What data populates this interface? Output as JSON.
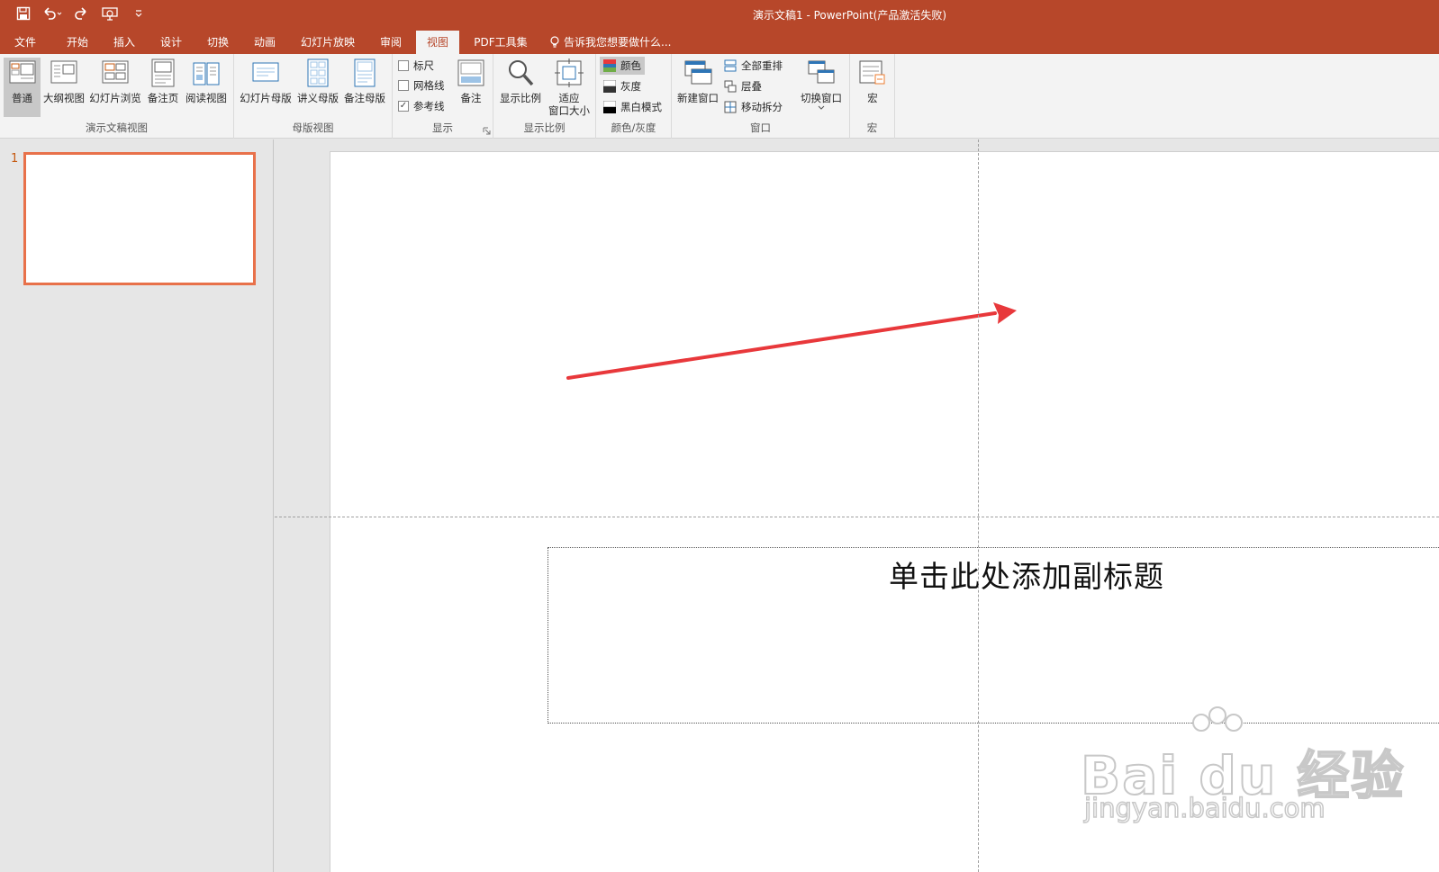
{
  "window": {
    "title": "演示文稿1 - PowerPoint(产品激活失败)"
  },
  "qat": {
    "save_icon": "save-icon",
    "undo_icon": "undo-icon",
    "redo_icon": "redo-icon",
    "present_icon": "present-from-start-icon",
    "customize_icon": "customize-qat-icon"
  },
  "tabs": [
    {
      "label": "文件"
    },
    {
      "label": "开始"
    },
    {
      "label": "插入"
    },
    {
      "label": "设计"
    },
    {
      "label": "切换"
    },
    {
      "label": "动画"
    },
    {
      "label": "幻灯片放映"
    },
    {
      "label": "审阅"
    },
    {
      "label": "视图",
      "active": true
    },
    {
      "label": "PDF工具集"
    }
  ],
  "tell_me": "告诉我您想要做什么...",
  "ribbon": {
    "presentation_views": {
      "label": "演示文稿视图",
      "buttons": [
        {
          "label": "普通",
          "active": true
        },
        {
          "label": "大纲视图"
        },
        {
          "label": "幻灯片浏览"
        },
        {
          "label": "备注页"
        },
        {
          "label": "阅读视图"
        }
      ]
    },
    "master_views": {
      "label": "母版视图",
      "buttons": [
        {
          "label": "幻灯片母版"
        },
        {
          "label": "讲义母版"
        },
        {
          "label": "备注母版"
        }
      ]
    },
    "show": {
      "label": "显示",
      "ruler": {
        "label": "标尺",
        "checked": false
      },
      "gridlines": {
        "label": "网格线",
        "checked": false
      },
      "guides": {
        "label": "参考线",
        "checked": true
      },
      "notes": {
        "label": "备注"
      },
      "check_mark": "✓"
    },
    "zoom": {
      "label": "显示比例",
      "zoom_btn": "显示比例",
      "fit_line1": "适应",
      "fit_line2": "窗口大小"
    },
    "color": {
      "label": "颜色/灰度",
      "color": "颜色",
      "grayscale": "灰度",
      "bw": "黑白模式"
    },
    "window": {
      "label": "窗口",
      "new_window": "新建窗口",
      "arrange_all": "全部重排",
      "cascade": "层叠",
      "move_split": "移动拆分",
      "switch_windows": "切换窗口"
    },
    "macros": {
      "label": "宏",
      "macros_btn": "宏"
    }
  },
  "thumbnails": [
    {
      "number": "1"
    }
  ],
  "slide": {
    "subtitle_placeholder": "单击此处添加副标题"
  },
  "watermark": {
    "brand": "Bai du 经验",
    "url": "jingyan.baidu.com"
  },
  "colors": {
    "accent": "#b7472a",
    "arrow": "#e8383b",
    "thumb_border": "#e8714a"
  }
}
